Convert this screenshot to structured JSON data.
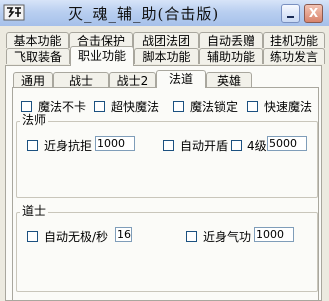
{
  "window": {
    "title": "灭_魂_辅_助(合击版)",
    "icon": "app-logo-icon",
    "close_label": "X"
  },
  "main_tabs_row1": [
    {
      "label": "基本功能"
    },
    {
      "label": "合击保护"
    },
    {
      "label": "战团法团"
    },
    {
      "label": "自动丢赠"
    },
    {
      "label": "挂机功能"
    }
  ],
  "main_tabs_row2": [
    {
      "label": "飞取装备"
    },
    {
      "label": "职业功能",
      "active": true
    },
    {
      "label": "脚本功能"
    },
    {
      "label": "辅助功能"
    },
    {
      "label": "练功发言"
    }
  ],
  "class_tabs": [
    {
      "label": "通用"
    },
    {
      "label": "战士"
    },
    {
      "label": "战士2"
    },
    {
      "label": "法道",
      "active": true
    },
    {
      "label": "英雄"
    }
  ],
  "mage_top_options": [
    {
      "label": "魔法不卡",
      "checked": false
    },
    {
      "label": "超快魔法",
      "checked": false
    },
    {
      "label": "魔法锁定",
      "checked": false
    },
    {
      "label": "快速魔法",
      "checked": false
    }
  ],
  "mage_group": {
    "title": "法师",
    "near_resist": {
      "label": "近身抗拒",
      "checked": false,
      "value": "1000"
    },
    "auto_shield": {
      "label": "自动开盾",
      "checked": false
    },
    "level4": {
      "label": "4级",
      "checked": false,
      "value": "5000"
    }
  },
  "taoist_group": {
    "title": "道士",
    "auto_invisible": {
      "label": "自动无极/秒",
      "checked": false,
      "value": "16"
    },
    "near_qigong": {
      "label": "近身气功",
      "checked": false,
      "value": "1000"
    }
  }
}
